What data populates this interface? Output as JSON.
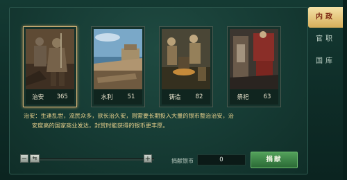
{
  "cards": [
    {
      "name": "治安",
      "value": "365",
      "active": true
    },
    {
      "name": "水利",
      "value": "51",
      "active": false
    },
    {
      "name": "铸造",
      "value": "82",
      "active": false
    },
    {
      "name": "祭祀",
      "value": "63",
      "active": false
    }
  ],
  "description": {
    "line1": "治安：生逢乱世，流民众多，欲长治久安，则需要长期投入大量的银币整治治安，治",
    "line2": "安度高的国家商业发达，封赏时能获得的银币更丰厚。"
  },
  "slider": {
    "minus": "−",
    "plus": "+",
    "handle": "⇆"
  },
  "donate": {
    "label": "捐献银币",
    "value": "0",
    "button": "捐献"
  },
  "tabs": [
    {
      "label": "内政",
      "active": true
    },
    {
      "label": "官职",
      "active": false
    },
    {
      "label": "国库",
      "active": false
    }
  ]
}
